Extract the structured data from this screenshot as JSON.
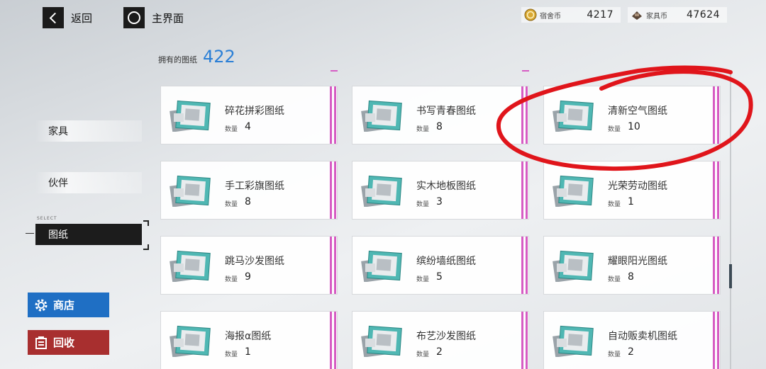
{
  "topbar": {
    "back_label": "返回",
    "home_label": "主界面"
  },
  "currencies": [
    {
      "name": "宿舍币",
      "value": "4217",
      "icon": "coin-icon",
      "color": "#d9a934"
    },
    {
      "name": "家具币",
      "value": "47624",
      "icon": "furniture-coin-icon",
      "color": "#5a4638"
    }
  ],
  "owned": {
    "label": "拥有的图纸",
    "count": "422"
  },
  "sidebar": {
    "select_caption": "SELECT",
    "items": [
      {
        "label": "家具",
        "active": false
      },
      {
        "label": "伙伴",
        "active": false
      },
      {
        "label": "图纸",
        "active": true
      }
    ],
    "shop_label": "商店",
    "recycle_label": "回收"
  },
  "grid": {
    "qty_label": "数量",
    "cards": [
      {
        "name": "碎花拼彩图纸",
        "qty": "4"
      },
      {
        "name": "书写青春图纸",
        "qty": "8"
      },
      {
        "name": "清新空气图纸",
        "qty": "10"
      },
      {
        "name": "手工彩旗图纸",
        "qty": "8"
      },
      {
        "name": "实木地板图纸",
        "qty": "3"
      },
      {
        "name": "光荣劳动图纸",
        "qty": "1"
      },
      {
        "name": "跳马沙发图纸",
        "qty": "9"
      },
      {
        "name": "缤纷墙纸图纸",
        "qty": "5"
      },
      {
        "name": "耀眼阳光图纸",
        "qty": "8"
      },
      {
        "name": "海报α图纸",
        "qty": "1"
      },
      {
        "name": "布艺沙发图纸",
        "qty": "2"
      },
      {
        "name": "自动贩卖机图纸",
        "qty": "2"
      }
    ]
  },
  "colors": {
    "accent_blue": "#2b7fd6",
    "shop_blue": "#1f6fc4",
    "recycle_red": "#a82f2f",
    "rarity_pink": "#d65cc3",
    "annotation_red": "#e0151b",
    "thumb_teal": "#4fb7b3"
  }
}
